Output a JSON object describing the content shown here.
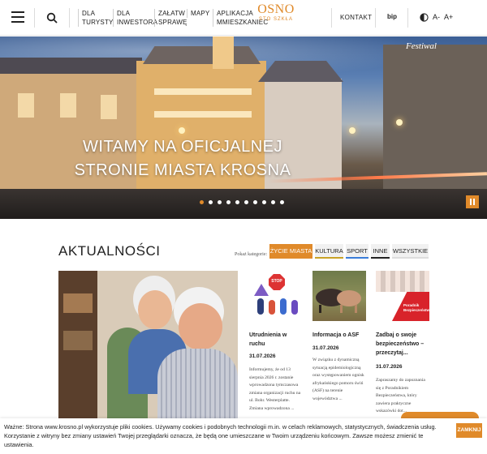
{
  "header": {
    "nav": [
      {
        "line1": "DLA",
        "line2": "TURYSTY"
      },
      {
        "line1": "DLA",
        "line2": "INWESTORA"
      },
      {
        "line1": "ZAŁATW",
        "line2": "SPRAWĘ"
      },
      {
        "line1": "MAPY",
        "line2": ""
      },
      {
        "line1": "APLIKACJA",
        "line2": "MMIESZKANIEC"
      }
    ],
    "logo_main": "OSNO",
    "logo_sub": "STO SZKŁA",
    "kontakt": "KONTAKT",
    "bip": "bip",
    "font_small": "A-",
    "font_large": "A+"
  },
  "hero": {
    "title_line1": "WITAMY NA OFICJALNEJ",
    "title_line2": "STRONIE MIASTA KROSNA",
    "sign_text": "Festiwal",
    "slides_count": 10,
    "active_slide": 0
  },
  "news": {
    "title": "AKTUALNOŚCI",
    "filter_label": "Pokaż kategorie:",
    "filters": [
      "ŻYCIE MIASTA",
      "KULTURA",
      "SPORT",
      "INNE",
      "WSZYSTKIE"
    ],
    "cards": [
      {
        "title_lines": [
          "Utrudnienia w",
          "ruchu"
        ],
        "date": "31.07.2026",
        "text_lines": [
          "Informujemy, że od 13",
          "sierpnia 2026 r. zostanie",
          "wprowadzona tymczasowa",
          "zmiana organizacji ruchu na",
          "ul. Bohr. Westerplatte.",
          "Zmiana wprowadzona ..."
        ],
        "img_sign": "STOP"
      },
      {
        "title_lines": [
          "Informacja o ASF",
          ""
        ],
        "date": "31.07.2026",
        "text_lines": [
          "W związku z dynamiczną",
          "sytuacją epidemiologiczną",
          "oraz występowaniem ognisk",
          "afrykańskiego pomoru świń",
          "(ASF) na terenie",
          "województwa ..."
        ],
        "img_sign": ""
      },
      {
        "title_lines": [
          "Zadbaj o swoje",
          "bezpieczeństwo –",
          "przeczytaj..."
        ],
        "date": "31.07.2026",
        "text_lines": [
          "Zapraszamy do zapoznania",
          "się z Poradnikiem",
          "Bezpieczeństwa, który",
          "zawiera praktyczne",
          "wskazówki dot..."
        ],
        "img_sign": "Poradnik Bezpieczeństwa"
      }
    ]
  },
  "cookie": {
    "line1": "Ważne: Strona www.krosno.pl wykorzystuje pliki cookies. Używamy cookies i podobnych technologii m.in. w celach reklamowych, statystycznych, świadczenia usług.",
    "line2": "Korzystanie z witryny bez zmiany ustawień Twojej przeglądarki oznacza, że będą one umieszczane w Twoim urządzeniu końcowym. Zawsze możesz zmienić te",
    "line3": "ustawienia.",
    "button": "ZAMKNIJ"
  },
  "colors": {
    "accent": "#e08a2a",
    "kultura": "#c9a227",
    "sport": "#3b7dd8",
    "inne": "#222222"
  },
  "icons": [
    "hamburger-icon",
    "search-icon",
    "contrast-icon",
    "pause-icon"
  ]
}
